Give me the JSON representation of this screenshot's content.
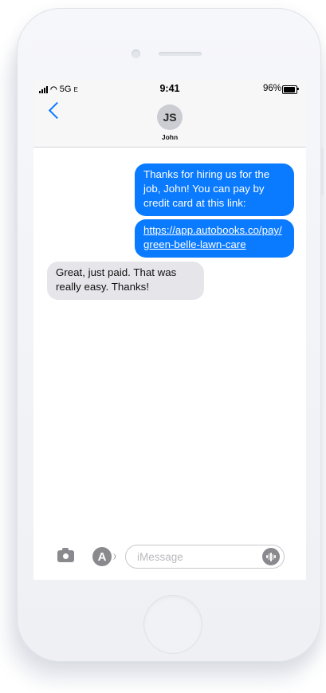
{
  "status_bar": {
    "carrier": "5G",
    "carrier_suffix": "E",
    "time": "9:41",
    "battery_percent": "96%",
    "battery_level": 0.96
  },
  "conversation": {
    "back_icon": "chevron-left-icon",
    "avatar_initials": "JS",
    "contact_name": "John"
  },
  "messages": {
    "m1": "Thanks for hiring us for the job, John! You can pay by credit card at this link:",
    "m2": "https://app.autobooks.co/pay/green-belle-lawn-care",
    "m3": "Great, just paid. That was really easy. Thanks!"
  },
  "composer": {
    "placeholder": "iMessage",
    "camera_icon": "camera-icon",
    "apps_icon": "app-store-icon",
    "audio_icon": "audio-waveform-icon"
  },
  "colors": {
    "outgoing_bubble": "#0a7aff",
    "incoming_bubble": "#e5e5ea",
    "phone_body": "#f3f4f7"
  }
}
